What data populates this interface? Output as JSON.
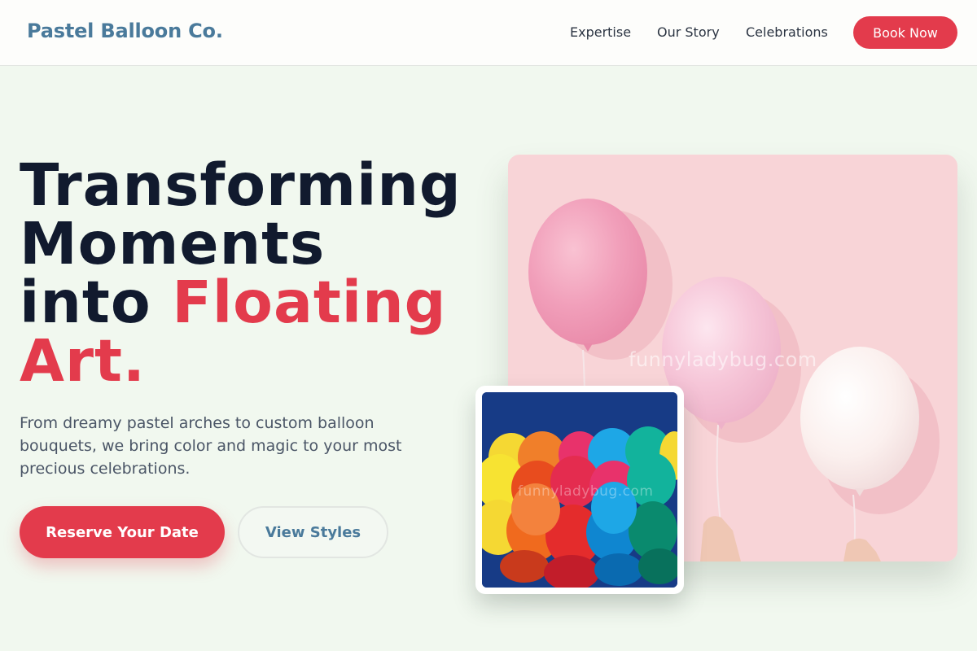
{
  "header": {
    "logo": "Pastel Balloon Co.",
    "nav": [
      {
        "label": "Expertise"
      },
      {
        "label": "Our Story"
      },
      {
        "label": "Celebrations"
      }
    ],
    "cta_label": "Book Now"
  },
  "hero": {
    "headline_line1": "Transforming",
    "headline_line2": "Moments",
    "headline_line3_plain": "into ",
    "headline_line3_accent": "Floating",
    "headline_line4_accent": "Art.",
    "subtext": "From dreamy pastel arches to custom balloon bouquets, we bring color and magic to your most precious celebrations.",
    "primary_button": "Reserve Your Date",
    "secondary_button": "View Styles"
  },
  "images": {
    "main_watermark": "funnyladybug.com",
    "small_watermark": "funnyladybug.com"
  },
  "colors": {
    "accent": "#e33b4c",
    "brand": "#4a7a9b",
    "background": "#f1f8ef",
    "heading": "#111a2e"
  }
}
